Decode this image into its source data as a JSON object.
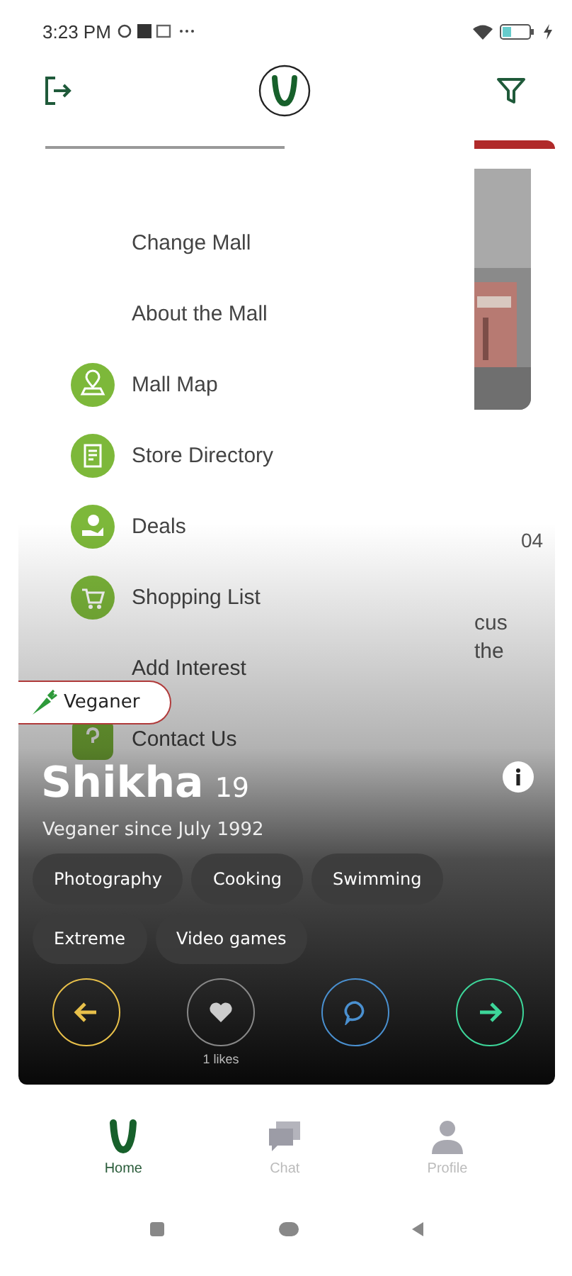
{
  "status_bar": {
    "time": "3:23 PM"
  },
  "drawer": {
    "items": [
      {
        "label": "Change Mall",
        "kind": "plain"
      },
      {
        "label": "About the Mall",
        "kind": "plain"
      },
      {
        "label": "Mall Map",
        "kind": "icon"
      },
      {
        "label": "Store Directory",
        "kind": "icon"
      },
      {
        "label": "Deals",
        "kind": "icon"
      },
      {
        "label": "Shopping List",
        "kind": "icon"
      },
      {
        "label": "Add Interest",
        "kind": "plain"
      },
      {
        "label": "Contact Us",
        "kind": "icon"
      }
    ]
  },
  "behind": {
    "date_fragment": "04",
    "text_lines": [
      "cus",
      "the"
    ]
  },
  "profile": {
    "badge": "Veganer",
    "name": "Shikha",
    "age": "19",
    "since": "Veganer since July 1992",
    "interests": [
      "Photography",
      "Cooking",
      "Swimming",
      "Extreme",
      "Video games"
    ],
    "likes": "1 likes"
  },
  "nav": [
    {
      "label": "Home",
      "selected": true
    },
    {
      "label": "Chat",
      "selected": false
    },
    {
      "label": "Profile",
      "selected": false
    }
  ]
}
